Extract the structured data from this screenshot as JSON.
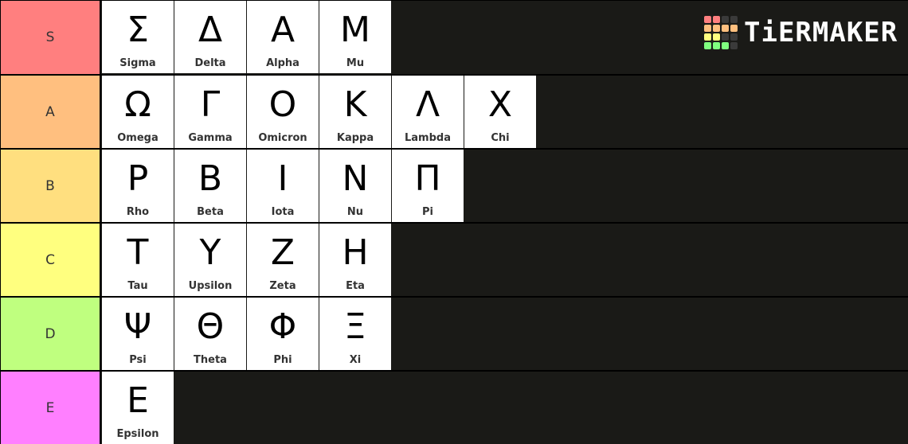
{
  "brand": {
    "name": "TiERMAKER",
    "grid_colors": [
      "#ff7f7f",
      "#ff7f7f",
      "#3a3a3a",
      "#3a3a3a",
      "#ffbf7f",
      "#ffbf7f",
      "#ffbf7f",
      "#ffbf7f",
      "#ffff7f",
      "#ffff7f",
      "#3a3a3a",
      "#3a3a3a",
      "#7fff7f",
      "#7fff7f",
      "#7fff7f",
      "#3a3a3a"
    ]
  },
  "tiers": [
    {
      "label": "S",
      "color": "#ff7f7f",
      "items": [
        {
          "glyph": "Σ",
          "name": "Sigma"
        },
        {
          "glyph": "Δ",
          "name": "Delta"
        },
        {
          "glyph": "Α",
          "name": "Alpha"
        },
        {
          "glyph": "Μ",
          "name": "Mu"
        }
      ]
    },
    {
      "label": "A",
      "color": "#ffbf7f",
      "items": [
        {
          "glyph": "Ω",
          "name": "Omega"
        },
        {
          "glyph": "Γ",
          "name": "Gamma"
        },
        {
          "glyph": "Ο",
          "name": "Omicron"
        },
        {
          "glyph": "Κ",
          "name": "Kappa"
        },
        {
          "glyph": "Λ",
          "name": "Lambda"
        },
        {
          "glyph": "Χ",
          "name": "Chi"
        }
      ]
    },
    {
      "label": "B",
      "color": "#ffdf7f",
      "items": [
        {
          "glyph": "Ρ",
          "name": "Rho"
        },
        {
          "glyph": "Β",
          "name": "Beta"
        },
        {
          "glyph": "Ι",
          "name": "Iota"
        },
        {
          "glyph": "Ν",
          "name": "Nu"
        },
        {
          "glyph": "Π",
          "name": "Pi"
        }
      ]
    },
    {
      "label": "C",
      "color": "#ffff7f",
      "items": [
        {
          "glyph": "Τ",
          "name": "Tau"
        },
        {
          "glyph": "Υ",
          "name": "Upsilon"
        },
        {
          "glyph": "Ζ",
          "name": "Zeta"
        },
        {
          "glyph": "Η",
          "name": "Eta"
        }
      ]
    },
    {
      "label": "D",
      "color": "#bfff7f",
      "items": [
        {
          "glyph": "Ψ",
          "name": "Psi"
        },
        {
          "glyph": "Θ",
          "name": "Theta"
        },
        {
          "glyph": "Φ",
          "name": "Phi"
        },
        {
          "glyph": "Ξ",
          "name": "Xi"
        }
      ]
    },
    {
      "label": "E",
      "color": "#ff7fff",
      "items": [
        {
          "glyph": "Ε",
          "name": "Epsilon"
        }
      ]
    }
  ]
}
